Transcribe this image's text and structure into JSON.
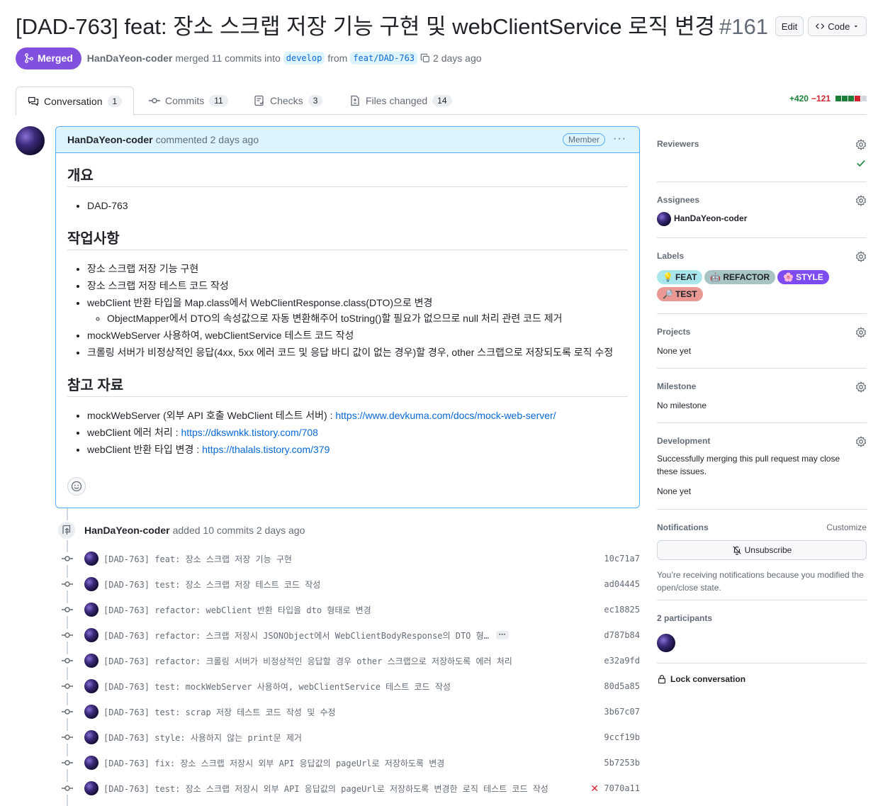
{
  "pr": {
    "title": "[DAD-763] feat: 장소 스크랩 저장 기능 구현 및 webClientService 로직 변경",
    "number": "#161",
    "edit_label": "Edit",
    "code_label": "Code",
    "status": "Merged",
    "author": "HanDaYeon-coder",
    "merged_text": "merged 11 commits into",
    "base_branch": "develop",
    "from_text": "from",
    "head_branch": "feat/DAD-763",
    "time": "2 days ago"
  },
  "tabs": [
    {
      "label": "Conversation",
      "count": "1"
    },
    {
      "label": "Commits",
      "count": "11"
    },
    {
      "label": "Checks",
      "count": "3"
    },
    {
      "label": "Files changed",
      "count": "14"
    }
  ],
  "diffstat": {
    "additions": "+420",
    "deletions": "−121"
  },
  "comment": {
    "author": "HanDaYeon-coder",
    "action": "commented 2 days ago",
    "badge": "Member",
    "sections": {
      "overview_title": "개요",
      "overview_items": [
        "DAD-763"
      ],
      "work_title": "작업사항",
      "work_items": [
        "장소 스크랩 저장 기능 구현",
        "장소 스크랩 저장 테스트 코드 작성",
        "webClient 반환 타입을 Map.class에서 WebClientResponse.class(DTO)으로 변경",
        "ObjectMapper에서 DTO의 속성값으로 자동 변환해주어 toString()할 필요가 없으므로 null 처리 관련 코드 제거",
        "mockWebServer 사용하여, webClientService 테스트 코드 작성",
        "크롤링 서버가 비정상적인 응답(4xx, 5xx 에러 코드 및 응답 바디 값이 없는 경우)할 경우, other 스크랩으로 저장되도록 로직 수정"
      ],
      "ref_title": "참고 자료",
      "refs": [
        {
          "label": "mockWebServer (외부 API 호출 WebClient 테스트 서버) : ",
          "link": "https://www.devkuma.com/docs/mock-web-server/"
        },
        {
          "label": "webClient 에러 처리 : ",
          "link": "https://dkswnkk.tistory.com/708"
        },
        {
          "label": "webClient 반환 타입 변경 : ",
          "link": "https://thalals.tistory.com/379"
        }
      ]
    }
  },
  "timeline": {
    "author": "HanDaYeon-coder",
    "action": "added 10 commits 2 days ago",
    "commits": [
      {
        "msg": "[DAD-763] feat: 장소 스크랩 저장 기능 구현",
        "sha": "10c71a7"
      },
      {
        "msg": "[DAD-763] test: 장소 스크랩 저장 테스트 코드 작성",
        "sha": "ad04445"
      },
      {
        "msg": "[DAD-763] refactor: webClient 반환 타입을 dto 형태로 변경",
        "sha": "ec18825"
      },
      {
        "msg": "[DAD-763] refactor: 스크랩 저장시 JSONObject에서 WebClientBodyResponse의 DTO 형…",
        "sha": "d787b84"
      },
      {
        "msg": "[DAD-763] refactor: 크롤링 서버가 비정상적인 응답할 경우 other 스크랩으로 저장하도록 에러 처리",
        "sha": "e32a9fd"
      },
      {
        "msg": "[DAD-763] test: mockWebServer 사용하여, webClientService 테스트 코드 작성",
        "sha": "80d5a85"
      },
      {
        "msg": "[DAD-763] test: scrap 저장 테스트 코드 작성 및 수정",
        "sha": "3b67c07"
      },
      {
        "msg": "[DAD-763] style: 사용하지 않는 print문 제거",
        "sha": "9ccf19b"
      },
      {
        "msg": "[DAD-763] fix: 장소 스크랩 저장시 외부 API 응답값의 pageUrl로 저장하도록 변경",
        "sha": "5b7253b"
      },
      {
        "msg": "[DAD-763] test: 장소 스크랩 저장시 외부 API 응답값의 pageUrl로 저장하도록 변경한 로직 테스트 코드 작성",
        "sha": "7070a11"
      }
    ]
  },
  "sidebar": {
    "reviewers_title": "Reviewers",
    "assignees_title": "Assignees",
    "assignee": "HanDaYeon-coder",
    "labels_title": "Labels",
    "labels": [
      {
        "emoji": "💡",
        "name": "FEAT",
        "bg": "#a8e6ec",
        "fg": "#1f2328"
      },
      {
        "emoji": "🤖",
        "name": "REFACTOR",
        "bg": "#a9c4c4",
        "fg": "#1f2328"
      },
      {
        "emoji": "🌸",
        "name": "STYLE",
        "bg": "#7d4cf0",
        "fg": "#ffffff"
      },
      {
        "emoji": "🔎",
        "name": "TEST",
        "bg": "#e99893",
        "fg": "#1f2328"
      }
    ],
    "projects_title": "Projects",
    "projects_value": "None yet",
    "milestone_title": "Milestone",
    "milestone_value": "No milestone",
    "development_title": "Development",
    "development_text": "Successfully merging this pull request may close these issues.",
    "development_value": "None yet",
    "notifications_title": "Notifications",
    "customize_label": "Customize",
    "unsubscribe_label": "Unsubscribe",
    "notifications_text": "You’re receiving notifications because you modified the open/close state.",
    "participants_title": "2 participants",
    "lock_label": "Lock conversation"
  }
}
